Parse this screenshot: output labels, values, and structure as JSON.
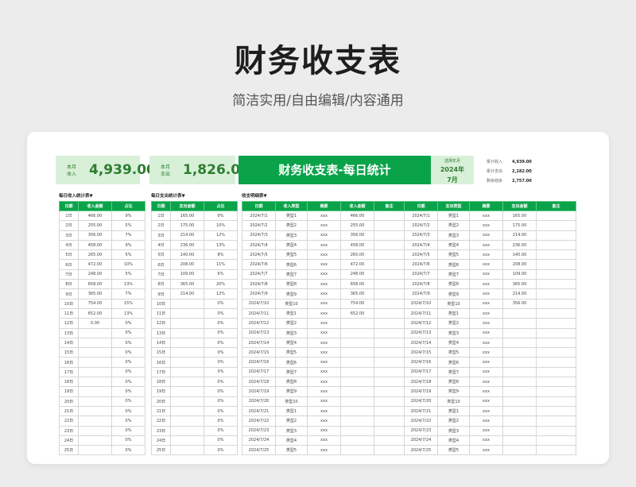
{
  "title": "财务收支表",
  "subtitle": "简洁实用/自由编辑/内容通用",
  "summary_income": {
    "label": "本月收入",
    "value": "4,939.00"
  },
  "summary_expense": {
    "label": "本月支出",
    "value": "1,826.00"
  },
  "banner": "财务收支表-每日统计",
  "period": {
    "label": "选择年月",
    "year": "2024年",
    "month": "7月"
  },
  "totals": [
    {
      "label": "累计收入",
      "value": "4,939.00"
    },
    {
      "label": "累计支出",
      "value": "2,182.00"
    },
    {
      "label": "剩余结余",
      "value": "2,757.00"
    }
  ],
  "income_section": {
    "title": "每日收入统计表▼",
    "headers": [
      "日期",
      "收入金额",
      "占比"
    ],
    "rows": [
      [
        "1日",
        "466.00",
        "9%"
      ],
      [
        "2日",
        "255.00",
        "5%"
      ],
      [
        "3日",
        "356.00",
        "7%"
      ],
      [
        "4日",
        "458.00",
        "9%"
      ],
      [
        "5日",
        "265.00",
        "5%"
      ],
      [
        "6日",
        "472.00",
        "10%"
      ],
      [
        "7日",
        "248.00",
        "5%"
      ],
      [
        "8日",
        "658.00",
        "13%"
      ],
      [
        "9日",
        "365.00",
        "7%"
      ],
      [
        "10日",
        "754.00",
        "15%"
      ],
      [
        "11日",
        "652.00",
        "13%"
      ],
      [
        "12日",
        "0.00",
        "0%"
      ],
      [
        "13日",
        "",
        "0%"
      ],
      [
        "14日",
        "",
        "0%"
      ],
      [
        "15日",
        "",
        "0%"
      ],
      [
        "16日",
        "",
        "0%"
      ],
      [
        "17日",
        "",
        "0%"
      ],
      [
        "18日",
        "",
        "0%"
      ],
      [
        "19日",
        "",
        "0%"
      ],
      [
        "20日",
        "",
        "0%"
      ],
      [
        "21日",
        "",
        "0%"
      ],
      [
        "22日",
        "",
        "0%"
      ],
      [
        "23日",
        "",
        "0%"
      ],
      [
        "24日",
        "",
        "0%"
      ],
      [
        "25日",
        "",
        "0%"
      ]
    ]
  },
  "expense_section": {
    "title": "每日支出统计表▼",
    "headers": [
      "日期",
      "支出金额",
      "占比"
    ],
    "rows": [
      [
        "1日",
        "165.00",
        "9%"
      ],
      [
        "2日",
        "175.00",
        "10%"
      ],
      [
        "3日",
        "214.00",
        "12%"
      ],
      [
        "4日",
        "236.00",
        "13%"
      ],
      [
        "5日",
        "140.00",
        "8%"
      ],
      [
        "6日",
        "208.00",
        "11%"
      ],
      [
        "7日",
        "109.00",
        "6%"
      ],
      [
        "8日",
        "365.00",
        "20%"
      ],
      [
        "9日",
        "214.00",
        "12%"
      ],
      [
        "10日",
        "",
        "0%"
      ],
      [
        "11日",
        "",
        "0%"
      ],
      [
        "12日",
        "",
        "0%"
      ],
      [
        "13日",
        "",
        "0%"
      ],
      [
        "14日",
        "",
        "0%"
      ],
      [
        "15日",
        "",
        "0%"
      ],
      [
        "16日",
        "",
        "0%"
      ],
      [
        "17日",
        "",
        "0%"
      ],
      [
        "18日",
        "",
        "0%"
      ],
      [
        "19日",
        "",
        "0%"
      ],
      [
        "20日",
        "",
        "0%"
      ],
      [
        "21日",
        "",
        "0%"
      ],
      [
        "22日",
        "",
        "0%"
      ],
      [
        "23日",
        "",
        "0%"
      ],
      [
        "24日",
        "",
        "0%"
      ],
      [
        "25日",
        "",
        "0%"
      ]
    ]
  },
  "detail_section": {
    "title": "收支明细表▼",
    "headers": [
      "日期",
      "收入类型",
      "摘要",
      "收入金额",
      "备注",
      "日期",
      "支出类型",
      "摘要",
      "支出金额",
      "备注"
    ],
    "rows": [
      [
        "2024/7/1",
        "类型1",
        "xxx",
        "466.00",
        "",
        "2024/7/1",
        "类型1",
        "xxx",
        "165.00",
        ""
      ],
      [
        "2024/7/2",
        "类型2",
        "xxx",
        "255.00",
        "",
        "2024/7/2",
        "类型2",
        "xxx",
        "175.00",
        ""
      ],
      [
        "2024/7/3",
        "类型3",
        "xxx",
        "356.00",
        "",
        "2024/7/3",
        "类型3",
        "xxx",
        "214.00",
        ""
      ],
      [
        "2024/7/4",
        "类型4",
        "xxx",
        "458.00",
        "",
        "2024/7/4",
        "类型4",
        "xxx",
        "236.00",
        ""
      ],
      [
        "2024/7/5",
        "类型5",
        "xxx",
        "265.00",
        "",
        "2024/7/5",
        "类型5",
        "xxx",
        "140.00",
        ""
      ],
      [
        "2024/7/6",
        "类型6",
        "xxx",
        "472.00",
        "",
        "2024/7/6",
        "类型6",
        "xxx",
        "208.00",
        ""
      ],
      [
        "2024/7/7",
        "类型7",
        "xxx",
        "248.00",
        "",
        "2024/7/7",
        "类型7",
        "xxx",
        "109.00",
        ""
      ],
      [
        "2024/7/8",
        "类型8",
        "xxx",
        "658.00",
        "",
        "2024/7/8",
        "类型8",
        "xxx",
        "365.00",
        ""
      ],
      [
        "2024/7/9",
        "类型9",
        "xxx",
        "365.00",
        "",
        "2024/7/9",
        "类型9",
        "xxx",
        "214.00",
        ""
      ],
      [
        "2024/7/10",
        "类型10",
        "xxx",
        "754.00",
        "",
        "2024/7/10",
        "类型10",
        "xxx",
        "356.00",
        ""
      ],
      [
        "2024/7/11",
        "类型1",
        "xxx",
        "652.00",
        "",
        "2024/7/11",
        "类型1",
        "xxx",
        "",
        ""
      ],
      [
        "2024/7/12",
        "类型2",
        "xxx",
        "",
        "",
        "2024/7/12",
        "类型2",
        "xxx",
        "",
        ""
      ],
      [
        "2024/7/13",
        "类型3",
        "xxx",
        "",
        "",
        "2024/7/13",
        "类型3",
        "xxx",
        "",
        ""
      ],
      [
        "2024/7/14",
        "类型4",
        "xxx",
        "",
        "",
        "2024/7/14",
        "类型4",
        "xxx",
        "",
        ""
      ],
      [
        "2024/7/15",
        "类型5",
        "xxx",
        "",
        "",
        "2024/7/15",
        "类型5",
        "xxx",
        "",
        ""
      ],
      [
        "2024/7/16",
        "类型6",
        "xxx",
        "",
        "",
        "2024/7/16",
        "类型6",
        "xxx",
        "",
        ""
      ],
      [
        "2024/7/17",
        "类型7",
        "xxx",
        "",
        "",
        "2024/7/17",
        "类型7",
        "xxx",
        "",
        ""
      ],
      [
        "2024/7/18",
        "类型8",
        "xxx",
        "",
        "",
        "2024/7/18",
        "类型8",
        "xxx",
        "",
        ""
      ],
      [
        "2024/7/19",
        "类型9",
        "xxx",
        "",
        "",
        "2024/7/19",
        "类型9",
        "xxx",
        "",
        ""
      ],
      [
        "2024/7/20",
        "类型10",
        "xxx",
        "",
        "",
        "2024/7/20",
        "类型10",
        "xxx",
        "",
        ""
      ],
      [
        "2024/7/21",
        "类型1",
        "xxx",
        "",
        "",
        "2024/7/21",
        "类型1",
        "xxx",
        "",
        ""
      ],
      [
        "2024/7/22",
        "类型2",
        "xxx",
        "",
        "",
        "2024/7/22",
        "类型2",
        "xxx",
        "",
        ""
      ],
      [
        "2024/7/23",
        "类型3",
        "xxx",
        "",
        "",
        "2024/7/23",
        "类型3",
        "xxx",
        "",
        ""
      ],
      [
        "2024/7/24",
        "类型4",
        "xxx",
        "",
        "",
        "2024/7/24",
        "类型4",
        "xxx",
        "",
        ""
      ],
      [
        "2024/7/25",
        "类型5",
        "xxx",
        "",
        "",
        "2024/7/25",
        "类型5",
        "xxx",
        "",
        ""
      ]
    ]
  },
  "colors": {
    "accent": "#0ba34a",
    "light": "#d8f0d8",
    "text_green": "#2e7d32"
  }
}
